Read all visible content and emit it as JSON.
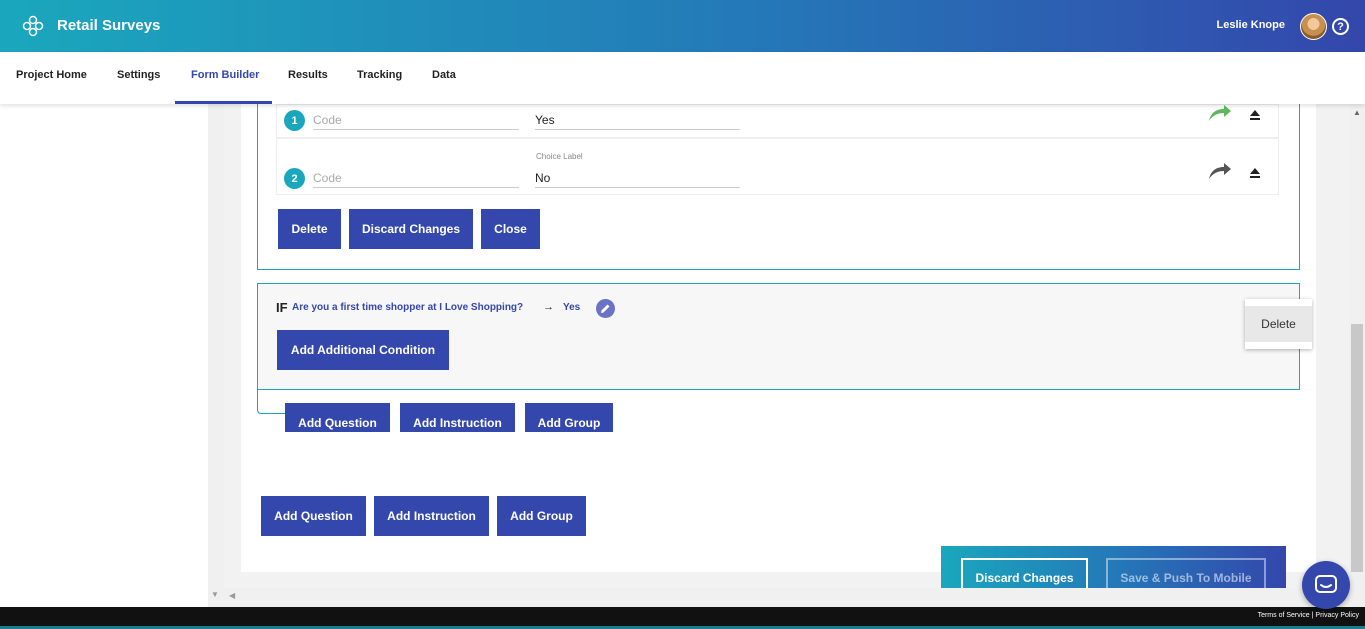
{
  "header": {
    "title": "Retail Surveys",
    "user_name": "Leslie Knope",
    "help_label": "?"
  },
  "nav": {
    "tabs": [
      {
        "label": "Project Home"
      },
      {
        "label": "Settings"
      },
      {
        "label": "Form Builder",
        "active": true
      },
      {
        "label": "Results"
      },
      {
        "label": "Tracking"
      },
      {
        "label": "Data"
      }
    ]
  },
  "question_card": {
    "choices": [
      {
        "number": "1",
        "code_placeholder": "Code",
        "label": "Yes",
        "arrow_color": "#5cb85c"
      },
      {
        "number": "2",
        "code_placeholder": "Code",
        "label_caption": "Choice Label",
        "label": "No",
        "arrow_color": "#555555"
      }
    ],
    "buttons": {
      "delete": "Delete",
      "discard": "Discard Changes",
      "close": "Close"
    }
  },
  "condition_card": {
    "if_label": "IF",
    "question": "Are you a first time shopper at I Love Shopping?",
    "arrow": "→",
    "answer": "Yes",
    "add_condition": "Add Additional Condition",
    "popup_delete": "Delete"
  },
  "inner_actions": {
    "add_question": "Add Question",
    "add_instruction": "Add Instruction",
    "add_group": "Add Group"
  },
  "outer_actions": {
    "add_question": "Add Question",
    "add_instruction": "Add Instruction",
    "add_group": "Add Group"
  },
  "save_bar": {
    "discard": "Discard Changes",
    "save_push": "Save & Push To Mobile"
  },
  "footer": {
    "terms": "Terms of Service",
    "separator": "|",
    "privacy": "Privacy Policy"
  },
  "colors": {
    "accent": "#3447ac",
    "teal": "#1aa7bd"
  }
}
